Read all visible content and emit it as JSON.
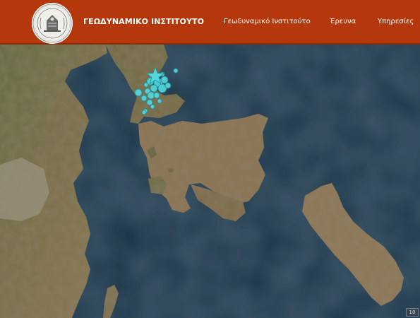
{
  "header": {
    "site_title": "ΓΕΩΔΥΝΑΜΙΚΟ ΙΝΣΤΙΤΟΥΤΟ",
    "nav": [
      {
        "label": "Γεωδυναμικό Ινστιτούτο"
      },
      {
        "label": "Έρευνα"
      },
      {
        "label": "Υπηρεσίες"
      }
    ],
    "logo_icon": "institute-seal-icon"
  },
  "map": {
    "base_layer": "satellite imagery",
    "corner_badge": "10",
    "colors": {
      "sea": "#1d3447",
      "land": "#8a7352",
      "marker_fill": "#55d6db",
      "marker_stroke": "#1f8c99",
      "header": "#b5370c"
    },
    "epicenter_icon": "star-icon",
    "event_marker_icon": "circle-marker-icon"
  }
}
